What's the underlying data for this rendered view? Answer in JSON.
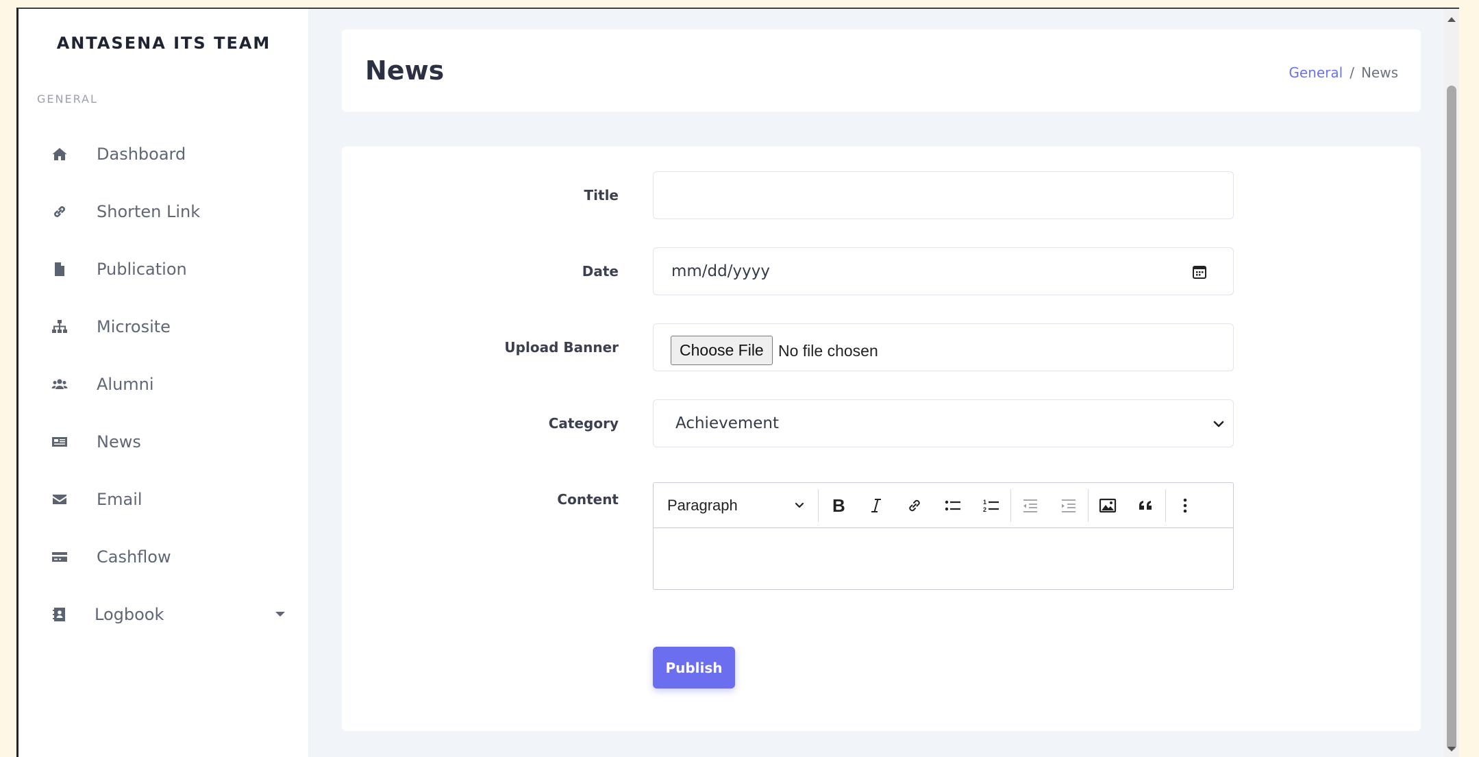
{
  "brand": "ANTASENA ITS TEAM",
  "sidebar": {
    "section_label": "GENERAL",
    "items": [
      {
        "label": "Dashboard",
        "icon": "home-icon"
      },
      {
        "label": "Shorten Link",
        "icon": "link-icon"
      },
      {
        "label": "Publication",
        "icon": "file-icon"
      },
      {
        "label": "Microsite",
        "icon": "sitemap-icon"
      },
      {
        "label": "Alumni",
        "icon": "users-icon"
      },
      {
        "label": "News",
        "icon": "newspaper-icon"
      },
      {
        "label": "Email",
        "icon": "envelope-icon"
      },
      {
        "label": "Cashflow",
        "icon": "credit-card-icon"
      },
      {
        "label": "Logbook",
        "icon": "address-book-icon"
      }
    ]
  },
  "header": {
    "title": "News",
    "breadcrumb": {
      "link": "General",
      "separator": "/",
      "current": "News"
    }
  },
  "form": {
    "title_label": "Title",
    "title_value": "",
    "date_label": "Date",
    "date_placeholder": "mm/dd/yyyy",
    "banner_label": "Upload Banner",
    "file_button": "Choose File",
    "file_status": "No file chosen",
    "category_label": "Category",
    "category_selected": "Achievement",
    "content_label": "Content",
    "editor_format": "Paragraph",
    "publish_label": "Publish"
  },
  "colors": {
    "accent": "#6c6ef0",
    "link": "#6a74e8",
    "background": "#f1f4f9"
  }
}
